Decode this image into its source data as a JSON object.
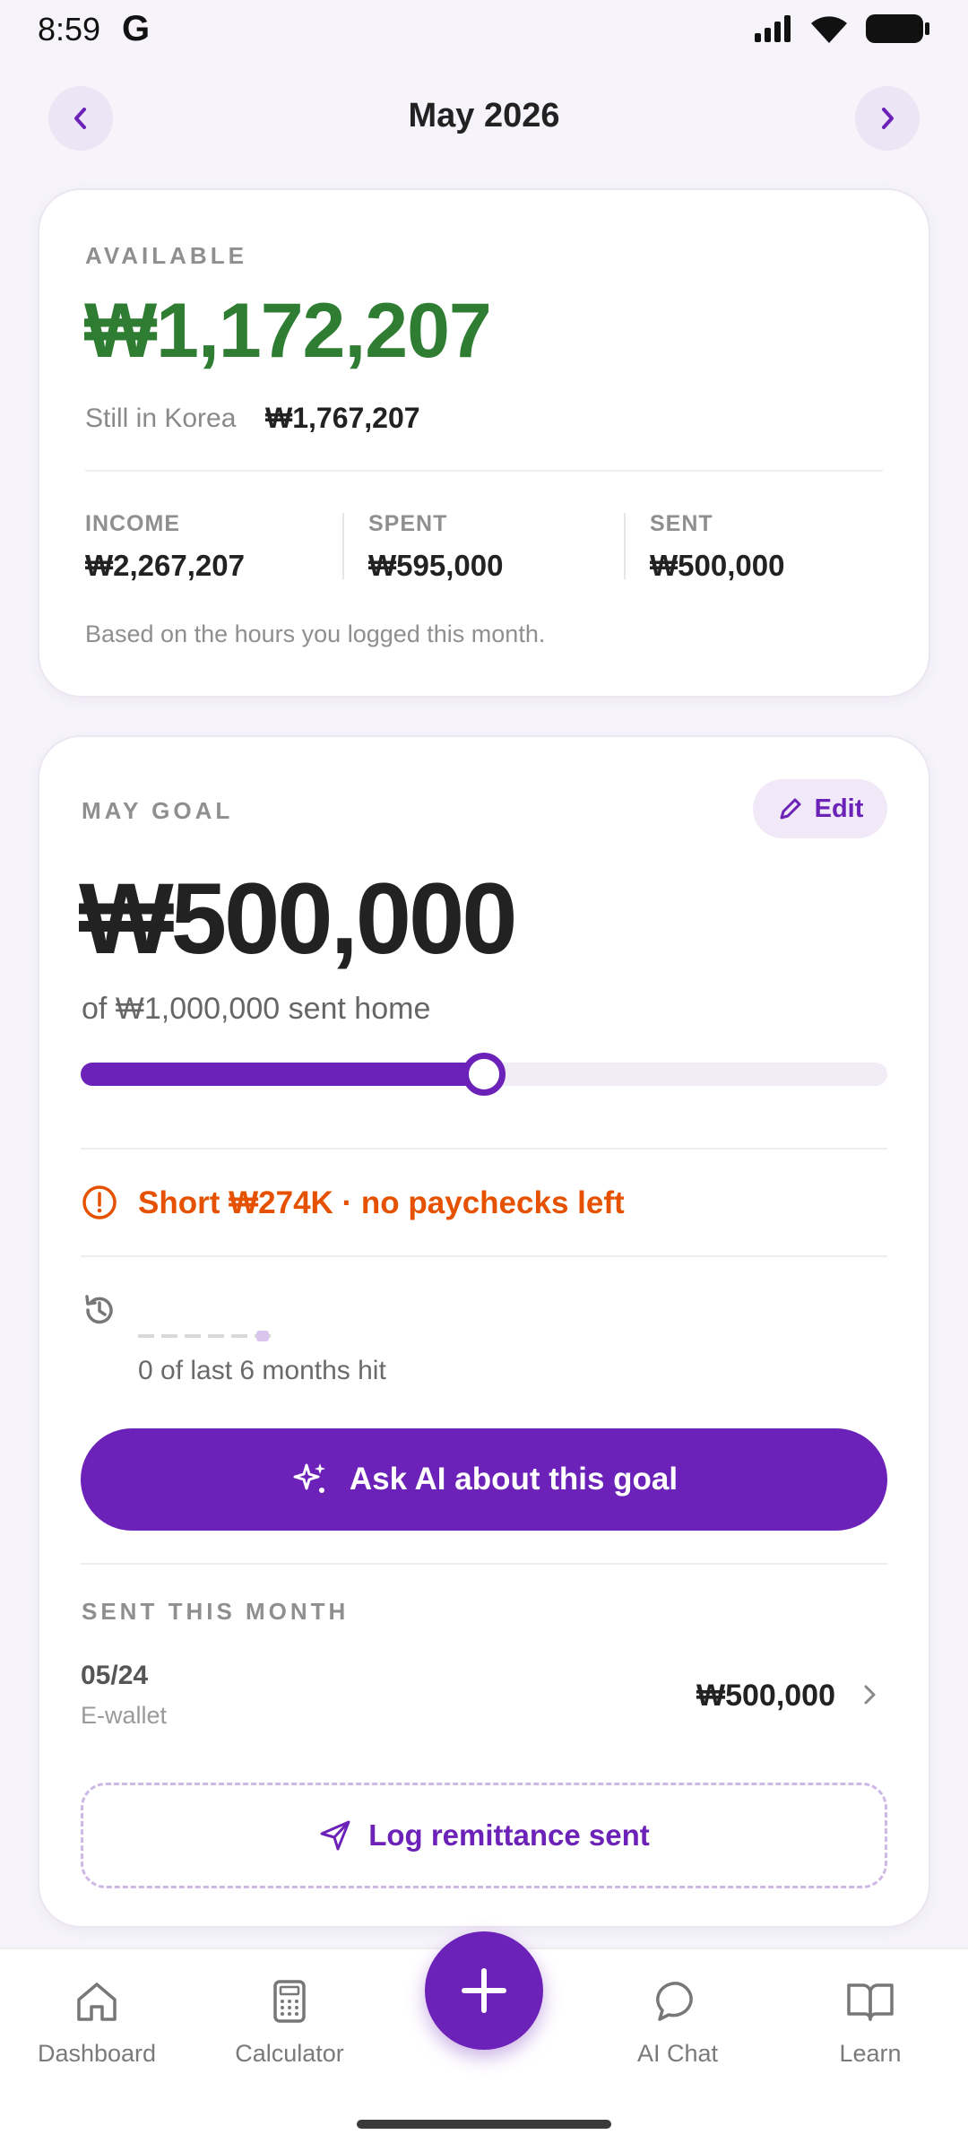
{
  "status_bar": {
    "time": "8:59",
    "app_letter": "G"
  },
  "header": {
    "month": "May 2026"
  },
  "summary": {
    "available_label": "AVAILABLE",
    "available_amount": "₩1,172,207",
    "still_label": "Still in Korea",
    "still_amount": "₩1,767,207",
    "stats": [
      {
        "label": "INCOME",
        "value": "₩2,267,207"
      },
      {
        "label": "SPENT",
        "value": "₩595,000"
      },
      {
        "label": "SENT",
        "value": "₩500,000"
      }
    ],
    "note": "Based on the hours you logged this month."
  },
  "goal": {
    "label": "MAY GOAL",
    "edit_label": "Edit",
    "amount": "₩500,000",
    "subtitle": "of ₩1,000,000 sent home",
    "progress_fraction": 0.5,
    "warning": "Short ₩274K · no paychecks left",
    "history_text": "0 of last 6 months hit",
    "ask_ai_label": "Ask AI about this goal"
  },
  "sent_this_month": {
    "label": "SENT THIS MONTH",
    "items": [
      {
        "date": "05/24",
        "method": "E-wallet",
        "amount": "₩500,000"
      }
    ],
    "log_button": "Log remittance sent"
  },
  "bottom_nav": {
    "items": [
      {
        "label": "Dashboard",
        "icon": "home-icon"
      },
      {
        "label": "Calculator",
        "icon": "calculator-icon"
      },
      {
        "label": "AI Chat",
        "icon": "chat-icon"
      },
      {
        "label": "Learn",
        "icon": "book-icon"
      }
    ],
    "fab_icon": "plus-icon"
  },
  "colors": {
    "accent": "#6c22b8",
    "available_green": "#2e7d32",
    "warning_orange": "#e65100"
  }
}
